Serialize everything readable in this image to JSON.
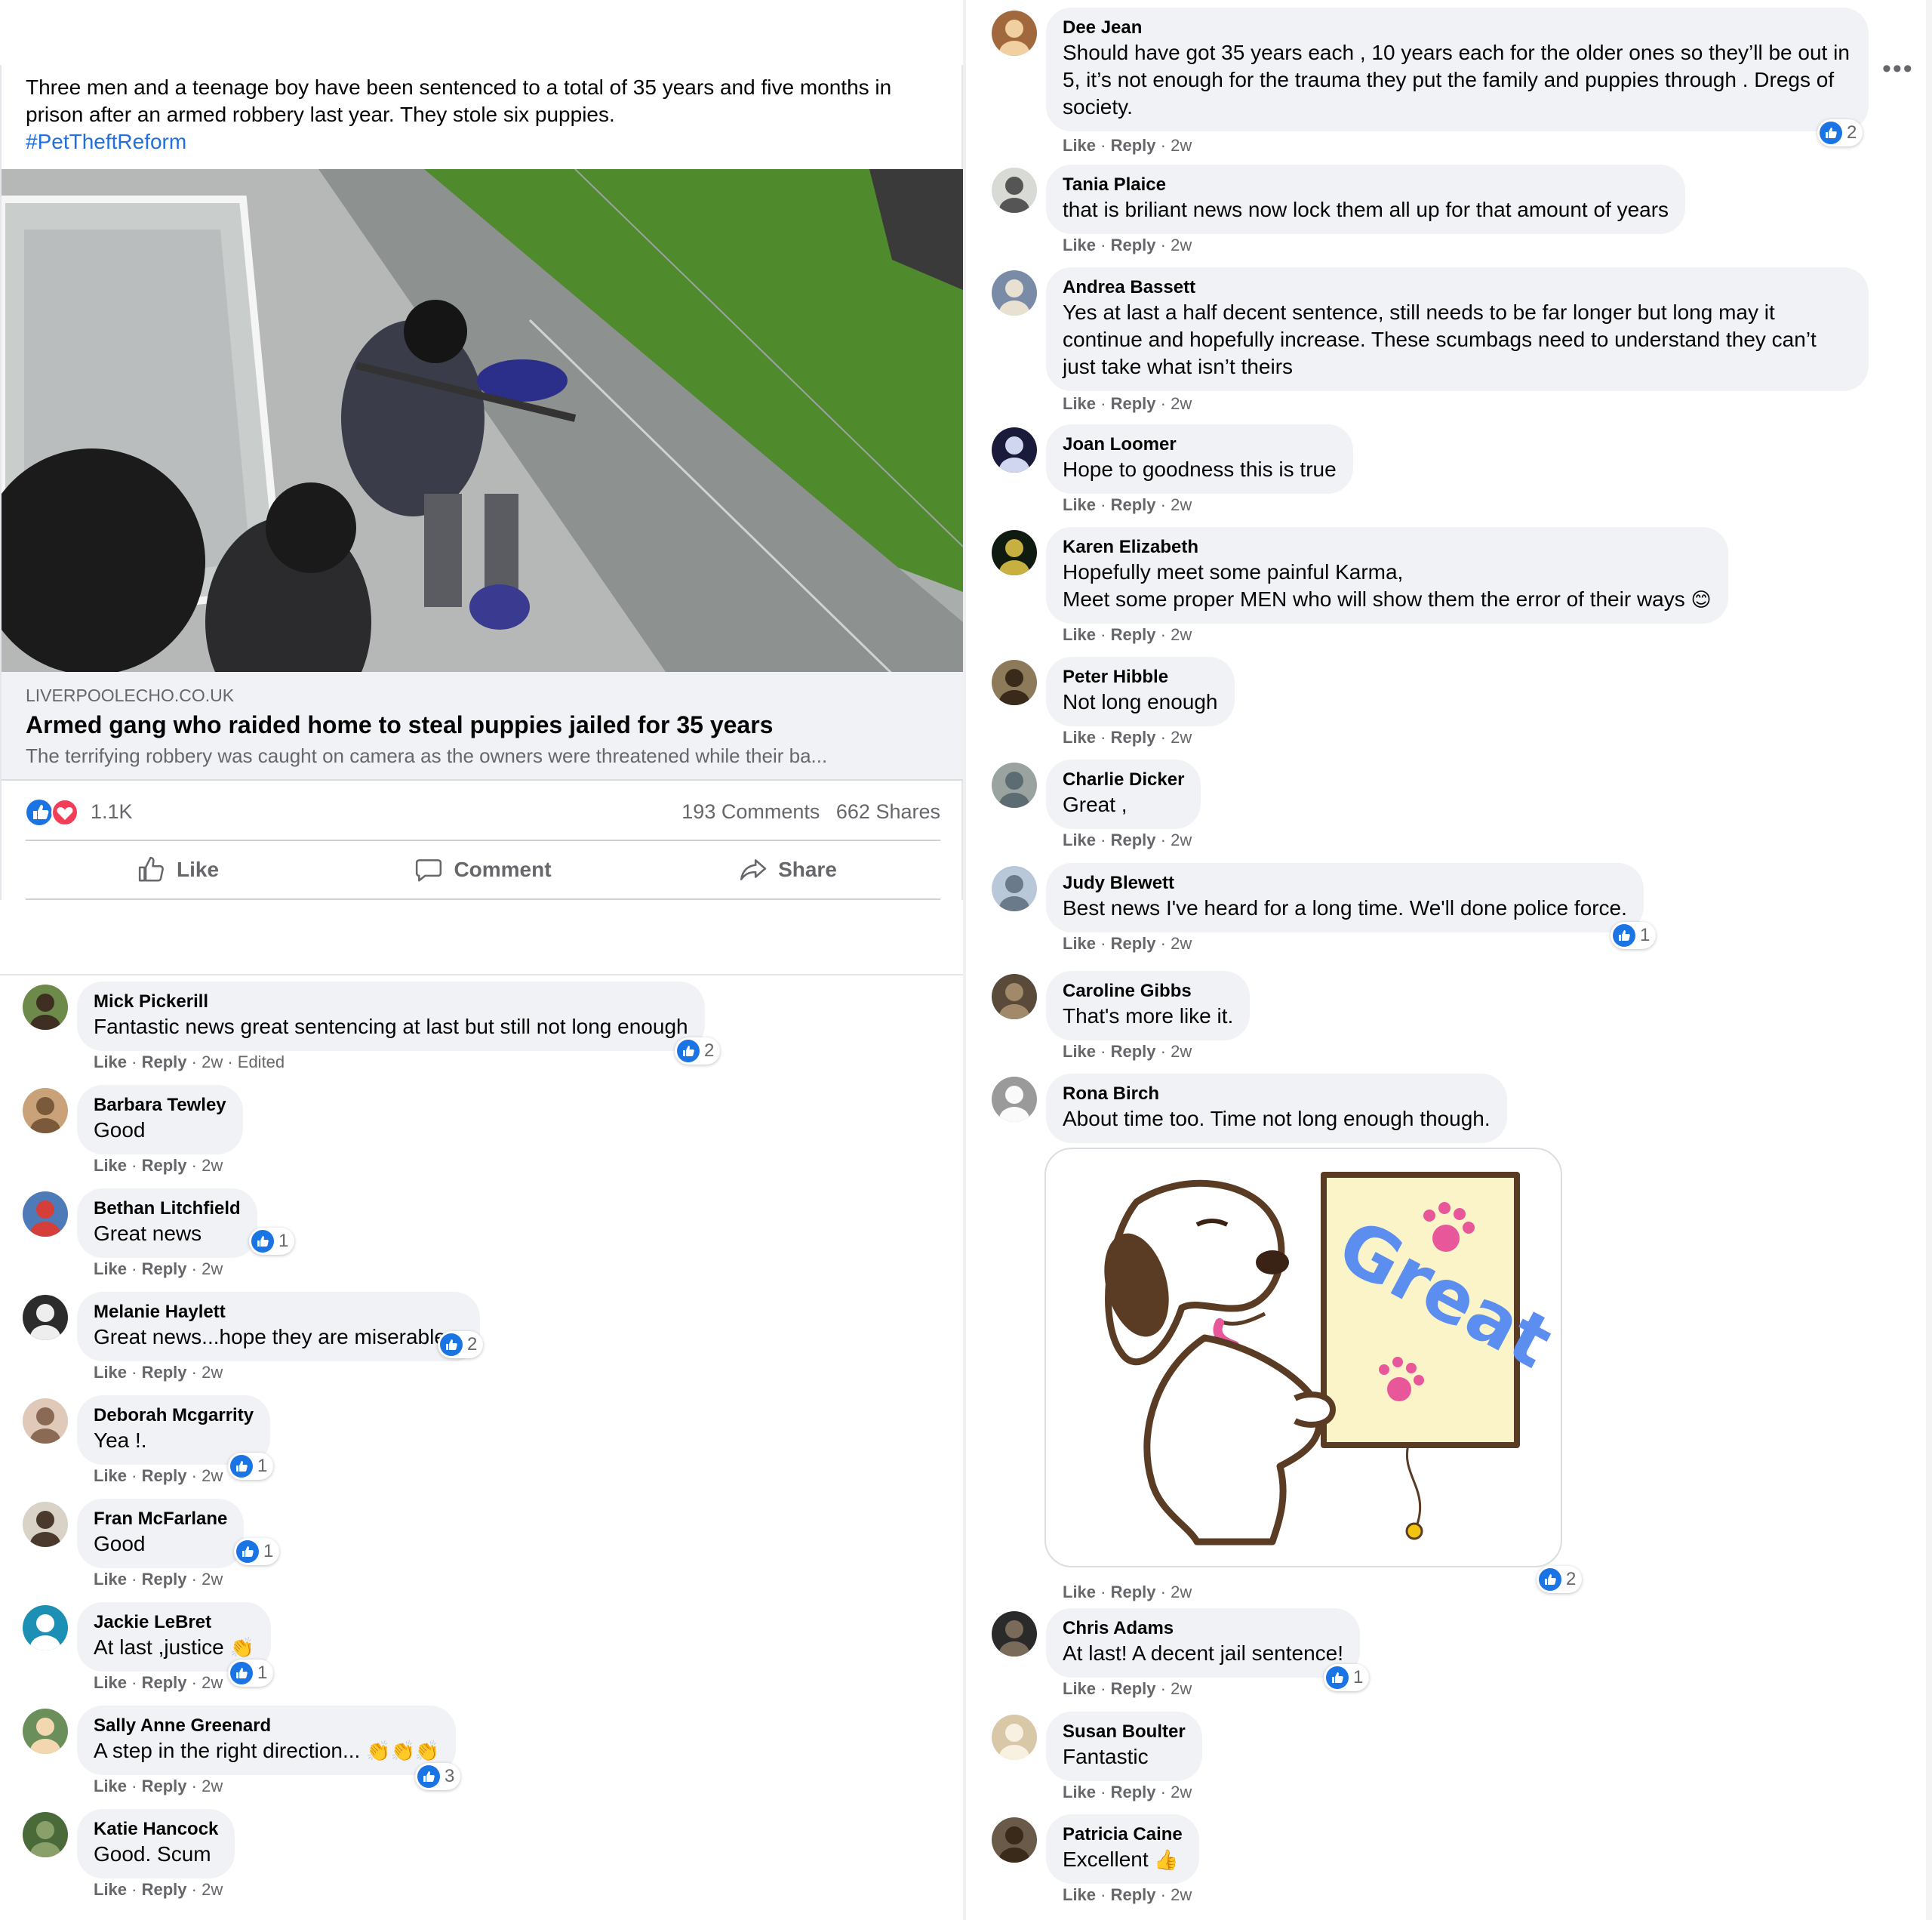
{
  "post": {
    "text": "Three men and a teenage boy have been sentenced to a total of 35 years and five months in prison after an armed robbery last year. They stole six puppies.",
    "hashtag": "#PetTheftReform",
    "link": {
      "domain": "LIVERPOOLECHO.CO.UK",
      "title": "Armed gang who raided home to steal puppies jailed for 35 years",
      "description": "The terrifying robbery was caught on camera as the owners were threatened while their ba..."
    },
    "info_label": "i",
    "reactions_count": "1.1K",
    "comments_count": "193 Comments",
    "shares_count": "662 Shares",
    "actions": {
      "like": "Like",
      "comment": "Comment",
      "share": "Share"
    }
  },
  "labels": {
    "like": "Like",
    "reply": "Reply",
    "sep": " · "
  },
  "comments_left": [
    {
      "name": "Mick Pickerill",
      "text": "Fantastic news great sentencing at last but still not long enough",
      "time": "2w",
      "edited": "Edited",
      "likes": "2"
    },
    {
      "name": "Barbara Tewley",
      "text": "Good",
      "time": "2w"
    },
    {
      "name": "Bethan Litchfield",
      "text": "Great news",
      "time": "2w",
      "likes": "1"
    },
    {
      "name": "Melanie Haylett",
      "text": "Great news...hope they are miserable...",
      "time": "2w",
      "likes": "2"
    },
    {
      "name": "Deborah Mcgarrity",
      "text": "Yea !.",
      "time": "2w",
      "likes": "1"
    },
    {
      "name": "Fran McFarlane",
      "text": "Good",
      "time": "2w",
      "likes": "1"
    },
    {
      "name": "Jackie LeBret",
      "text": "At last ,justice",
      "time": "2w",
      "likes": "1",
      "emoji": "👏"
    },
    {
      "name": "Sally Anne Greenard",
      "text": "A step in the right direction...",
      "time": "2w",
      "likes": "3",
      "emoji": "👏👏👏"
    },
    {
      "name": "Katie Hancock",
      "text": "Good. Scum",
      "time": "2w"
    }
  ],
  "comments_right": [
    {
      "name": "Dee Jean",
      "text": "Should have got 35 years each , 10 years each for the older ones so they’ll be out in 5, it’s not enough for the trauma they put the family and puppies through . Dregs of society.",
      "time": "2w",
      "likes": "2"
    },
    {
      "name": "Tania Plaice",
      "text": "that is briliant news now lock them all up for that amount of years",
      "time": "2w"
    },
    {
      "name": "Andrea Bassett",
      "text": "Yes at last a half decent sentence, still needs to be far longer but long may it continue and hopefully increase. These scumbags need to understand they can’t just take what isn’t theirs",
      "time": "2w"
    },
    {
      "name": "Joan Loomer",
      "text": "Hope to goodness this is true",
      "time": "2w"
    },
    {
      "name": "Karen Elizabeth",
      "text": "Hopefully meet some painful Karma,",
      "text2": "Meet some proper MEN who will show them the error of their ways",
      "emoji": "😊",
      "time": "2w"
    },
    {
      "name": "Peter Hibble",
      "text": "Not long enough",
      "time": "2w"
    },
    {
      "name": "Charlie Dicker",
      "text": "Great ,",
      "time": "2w"
    },
    {
      "name": "Judy Blewett",
      "text": "Best news I've heard for a long time. We'll done police force.",
      "time": "2w",
      "likes": "1"
    },
    {
      "name": "Caroline Gibbs",
      "text": "That's more like it.",
      "time": "2w"
    },
    {
      "name": "Rona Birch",
      "text": "About time too. Time not long enough though.",
      "time": "2w",
      "likes": "2",
      "sticker_text": "Great"
    },
    {
      "name": "Chris Adams",
      "text": "At last! A decent jail sentence!",
      "time": "2w",
      "likes": "1"
    },
    {
      "name": "Susan Boulter",
      "text": "Fantastic",
      "time": "2w"
    },
    {
      "name": "Patricia Caine",
      "text": "Excellent",
      "emoji": "👍",
      "time": "2w"
    }
  ],
  "colors": {
    "facebook_blue": "#1b74e4",
    "bubble": "#f0f2f5",
    "secondary_text": "#65676b",
    "hashtag": "#216fdb",
    "love_red": "#f33e58"
  }
}
